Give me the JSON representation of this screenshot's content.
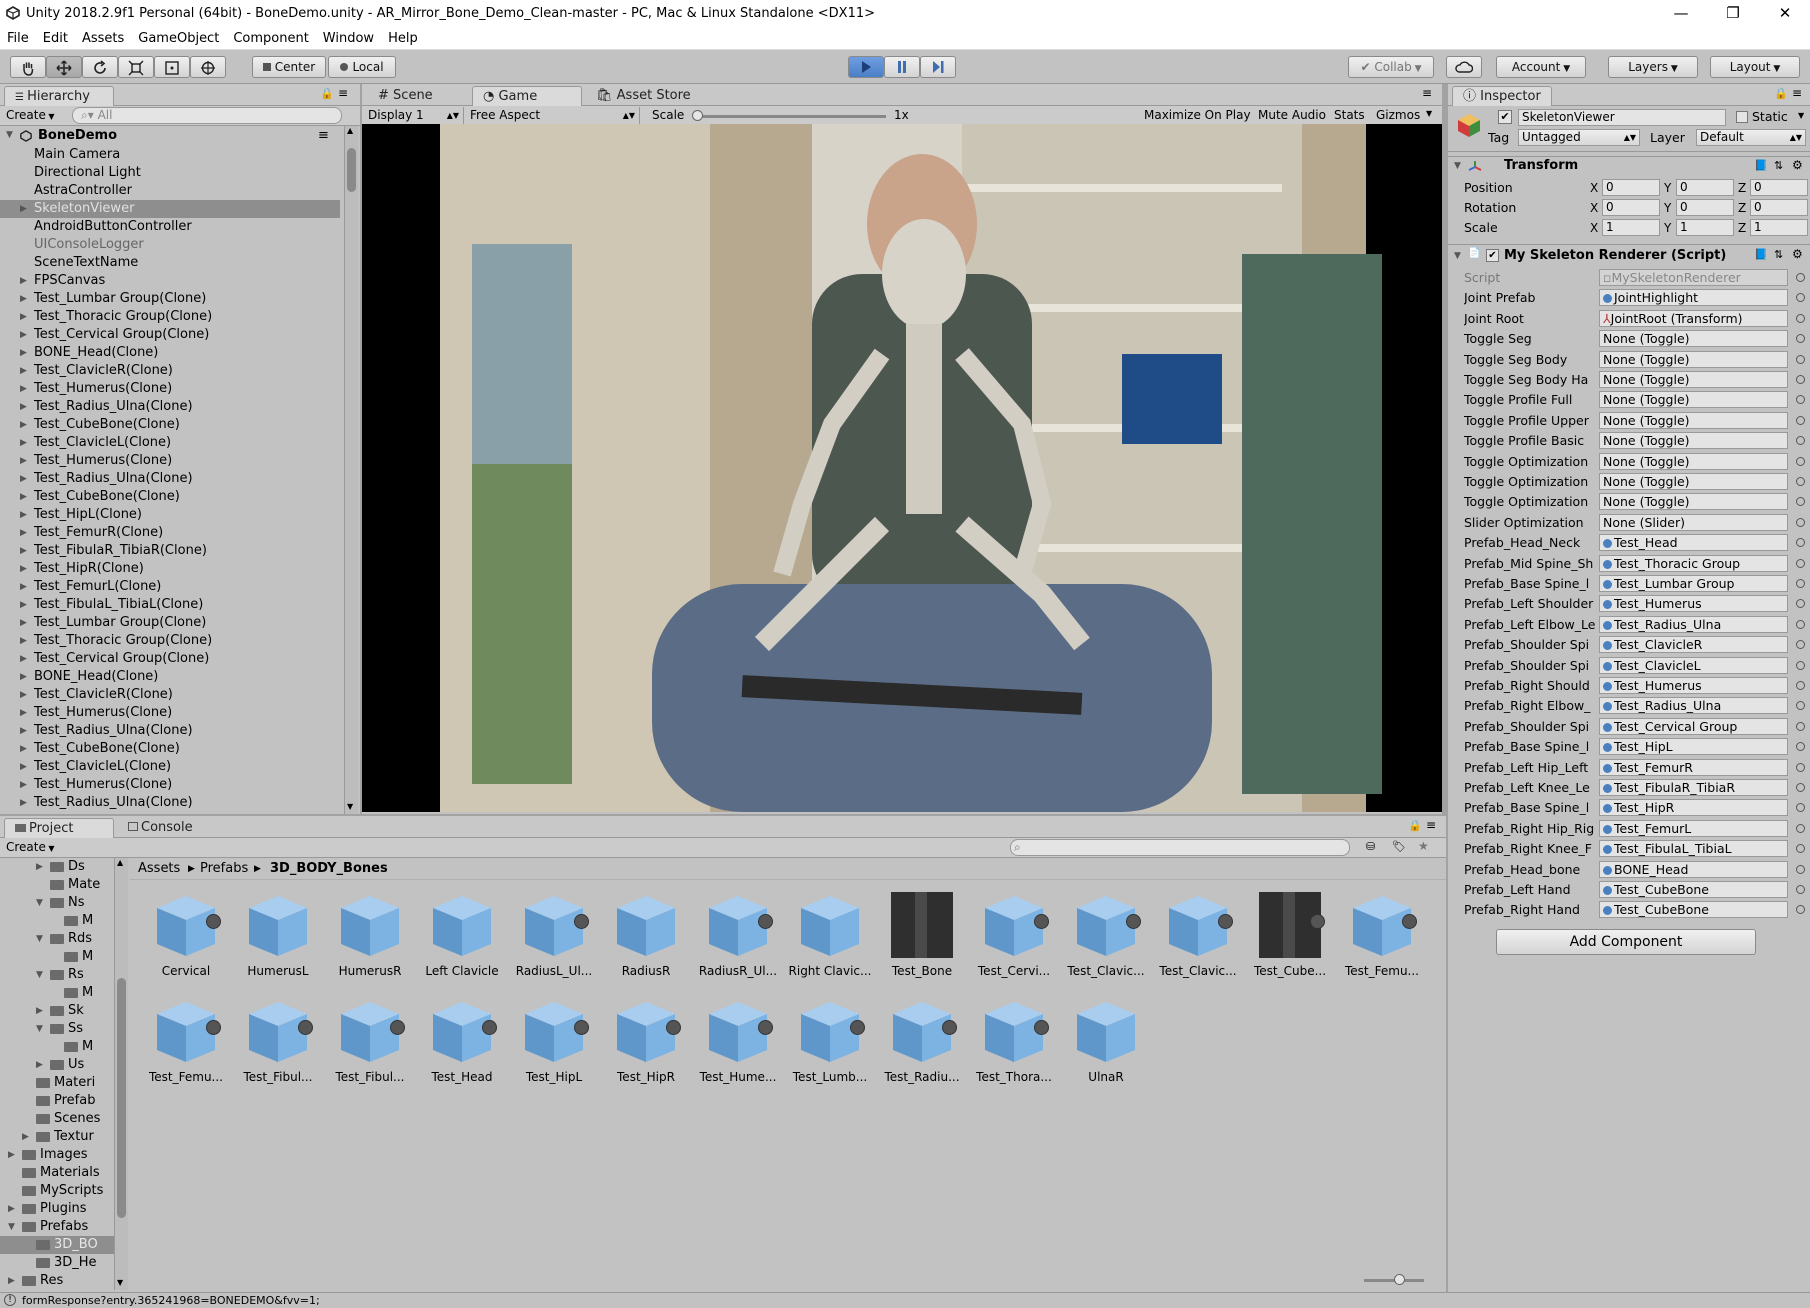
{
  "window": {
    "title": "Unity 2018.2.9f1 Personal (64bit) - BoneDemo.unity - AR_Mirror_Bone_Demo_Clean-master - PC, Mac & Linux Standalone <DX11>",
    "minimize": "—",
    "maximize": "❐",
    "close": "✕"
  },
  "menu": [
    "File",
    "Edit",
    "Assets",
    "GameObject",
    "Component",
    "Window",
    "Help"
  ],
  "toolbar": {
    "pivot": "Center",
    "space": "Local",
    "collab": "Collab",
    "account": "Account",
    "layers": "Layers",
    "layout": "Layout"
  },
  "hierarchy": {
    "tab": "Hierarchy",
    "create": "Create",
    "search_placeholder": "All",
    "scene": "BoneDemo",
    "items": [
      {
        "label": "Main Camera",
        "arrow": false,
        "dim": false
      },
      {
        "label": "Directional Light",
        "arrow": false,
        "dim": false
      },
      {
        "label": "AstraController",
        "arrow": false,
        "dim": false
      },
      {
        "label": "SkeletonViewer",
        "arrow": true,
        "dim": false,
        "selected": true
      },
      {
        "label": "AndroidButtonController",
        "arrow": false,
        "dim": false
      },
      {
        "label": "UIConsoleLogger",
        "arrow": false,
        "dim": true
      },
      {
        "label": "SceneTextName",
        "arrow": false,
        "dim": false
      },
      {
        "label": "FPSCanvas",
        "arrow": true,
        "dim": false
      },
      {
        "label": "Test_Lumbar Group(Clone)",
        "arrow": true,
        "dim": false
      },
      {
        "label": "Test_Thoracic Group(Clone)",
        "arrow": true,
        "dim": false
      },
      {
        "label": "Test_Cervical Group(Clone)",
        "arrow": true,
        "dim": false
      },
      {
        "label": "BONE_Head(Clone)",
        "arrow": true,
        "dim": false
      },
      {
        "label": "Test_ClavicleR(Clone)",
        "arrow": true,
        "dim": false
      },
      {
        "label": "Test_Humerus(Clone)",
        "arrow": true,
        "dim": false
      },
      {
        "label": "Test_Radius_Ulna(Clone)",
        "arrow": true,
        "dim": false
      },
      {
        "label": "Test_CubeBone(Clone)",
        "arrow": true,
        "dim": false
      },
      {
        "label": "Test_ClavicleL(Clone)",
        "arrow": true,
        "dim": false
      },
      {
        "label": "Test_Humerus(Clone)",
        "arrow": true,
        "dim": false
      },
      {
        "label": "Test_Radius_Ulna(Clone)",
        "arrow": true,
        "dim": false
      },
      {
        "label": "Test_CubeBone(Clone)",
        "arrow": true,
        "dim": false
      },
      {
        "label": "Test_HipL(Clone)",
        "arrow": true,
        "dim": false
      },
      {
        "label": "Test_FemurR(Clone)",
        "arrow": true,
        "dim": false
      },
      {
        "label": "Test_FibulaR_TibiaR(Clone)",
        "arrow": true,
        "dim": false
      },
      {
        "label": "Test_HipR(Clone)",
        "arrow": true,
        "dim": false
      },
      {
        "label": "Test_FemurL(Clone)",
        "arrow": true,
        "dim": false
      },
      {
        "label": "Test_FibulaL_TibiaL(Clone)",
        "arrow": true,
        "dim": false
      },
      {
        "label": "Test_Lumbar Group(Clone)",
        "arrow": true,
        "dim": false
      },
      {
        "label": "Test_Thoracic Group(Clone)",
        "arrow": true,
        "dim": false
      },
      {
        "label": "Test_Cervical Group(Clone)",
        "arrow": true,
        "dim": false
      },
      {
        "label": "BONE_Head(Clone)",
        "arrow": true,
        "dim": false
      },
      {
        "label": "Test_ClavicleR(Clone)",
        "arrow": true,
        "dim": false
      },
      {
        "label": "Test_Humerus(Clone)",
        "arrow": true,
        "dim": false
      },
      {
        "label": "Test_Radius_Ulna(Clone)",
        "arrow": true,
        "dim": false
      },
      {
        "label": "Test_CubeBone(Clone)",
        "arrow": true,
        "dim": false
      },
      {
        "label": "Test_ClavicleL(Clone)",
        "arrow": true,
        "dim": false
      },
      {
        "label": "Test_Humerus(Clone)",
        "arrow": true,
        "dim": false
      },
      {
        "label": "Test_Radius_Ulna(Clone)",
        "arrow": true,
        "dim": false
      }
    ]
  },
  "center": {
    "tabs": [
      "Scene",
      "Game",
      "Asset Store"
    ],
    "display": "Display 1",
    "aspect": "Free Aspect",
    "scale_label": "Scale",
    "scale_value": "1x",
    "scale_fraction": 0.0,
    "options": [
      "Maximize On Play",
      "Mute Audio",
      "Stats",
      "Gizmos"
    ]
  },
  "inspector": {
    "tab": "Inspector",
    "object_name": "SkeletonViewer",
    "static_label": "Static",
    "tag_label": "Tag",
    "tag_value": "Untagged",
    "layer_label": "Layer",
    "layer_value": "Default",
    "transform": {
      "title": "Transform",
      "rows": [
        {
          "label": "Position",
          "x": "0",
          "y": "0",
          "z": "0"
        },
        {
          "label": "Rotation",
          "x": "0",
          "y": "0",
          "z": "0"
        },
        {
          "label": "Scale",
          "x": "1",
          "y": "1",
          "z": "1"
        }
      ]
    },
    "script_component": {
      "title": "My Skeleton Renderer (Script)",
      "fields": [
        {
          "label": "Script",
          "value": "MySkeletonRenderer",
          "kind": "script"
        },
        {
          "label": "Joint Prefab",
          "value": "JointHighlight",
          "kind": "obj"
        },
        {
          "label": "Joint Root",
          "value": "JointRoot (Transform)",
          "kind": "transform"
        },
        {
          "label": "Toggle Seg",
          "value": "None (Toggle)",
          "kind": "none"
        },
        {
          "label": "Toggle Seg Body",
          "value": "None (Toggle)",
          "kind": "none"
        },
        {
          "label": "Toggle Seg Body Ha",
          "value": "None (Toggle)",
          "kind": "none"
        },
        {
          "label": "Toggle Profile Full",
          "value": "None (Toggle)",
          "kind": "none"
        },
        {
          "label": "Toggle Profile Upper",
          "value": "None (Toggle)",
          "kind": "none"
        },
        {
          "label": "Toggle Profile Basic",
          "value": "None (Toggle)",
          "kind": "none"
        },
        {
          "label": "Toggle Optimization",
          "value": "None (Toggle)",
          "kind": "none"
        },
        {
          "label": "Toggle Optimization",
          "value": "None (Toggle)",
          "kind": "none"
        },
        {
          "label": "Toggle Optimization",
          "value": "None (Toggle)",
          "kind": "none"
        },
        {
          "label": "Slider Optimization",
          "value": "None (Slider)",
          "kind": "none"
        },
        {
          "label": "Prefab_Head_Neck",
          "value": "Test_Head",
          "kind": "obj"
        },
        {
          "label": "Prefab_Mid Spine_Sh",
          "value": "Test_Thoracic Group",
          "kind": "obj"
        },
        {
          "label": "Prefab_Base Spine_l",
          "value": "Test_Lumbar Group",
          "kind": "obj"
        },
        {
          "label": "Prefab_Left Shoulder",
          "value": "Test_Humerus",
          "kind": "obj"
        },
        {
          "label": "Prefab_Left Elbow_Le",
          "value": "Test_Radius_Ulna",
          "kind": "obj"
        },
        {
          "label": "Prefab_Shoulder Spi",
          "value": "Test_ClavicleR",
          "kind": "obj"
        },
        {
          "label": "Prefab_Shoulder Spi",
          "value": "Test_ClavicleL",
          "kind": "obj"
        },
        {
          "label": "Prefab_Right Should",
          "value": "Test_Humerus",
          "kind": "obj"
        },
        {
          "label": "Prefab_Right Elbow_",
          "value": "Test_Radius_Ulna",
          "kind": "obj"
        },
        {
          "label": "Prefab_Shoulder Spi",
          "value": "Test_Cervical Group",
          "kind": "obj"
        },
        {
          "label": "Prefab_Base Spine_l",
          "value": "Test_HipL",
          "kind": "obj"
        },
        {
          "label": "Prefab_Left Hip_Left",
          "value": "Test_FemurR",
          "kind": "obj"
        },
        {
          "label": "Prefab_Left Knee_Le",
          "value": "Test_FibulaR_TibiaR",
          "kind": "obj"
        },
        {
          "label": "Prefab_Base Spine_l",
          "value": "Test_HipR",
          "kind": "obj"
        },
        {
          "label": "Prefab_Right Hip_Rig",
          "value": "Test_FemurL",
          "kind": "obj"
        },
        {
          "label": "Prefab_Right Knee_F",
          "value": "Test_FibulaL_TibiaL",
          "kind": "obj"
        },
        {
          "label": "Prefab_Head_bone",
          "value": "BONE_Head",
          "kind": "obj"
        },
        {
          "label": "Prefab_Left Hand",
          "value": "Test_CubeBone",
          "kind": "obj"
        },
        {
          "label": "Prefab_Right Hand",
          "value": "Test_CubeBone",
          "kind": "obj"
        }
      ]
    },
    "add_component": "Add Component"
  },
  "project": {
    "tabs": [
      "Project",
      "Console"
    ],
    "create": "Create",
    "breadcrumb": [
      "Assets",
      "Prefabs",
      "3D_BODY_Bones"
    ],
    "tree": [
      {
        "label": "Ds",
        "indent": 3,
        "arrow": "right"
      },
      {
        "label": "Mate",
        "indent": 3,
        "arrow": "none"
      },
      {
        "label": "Ns",
        "indent": 3,
        "arrow": "down"
      },
      {
        "label": "M",
        "indent": 4,
        "arrow": "none"
      },
      {
        "label": "Rds",
        "indent": 3,
        "arrow": "down"
      },
      {
        "label": "M",
        "indent": 4,
        "arrow": "none"
      },
      {
        "label": "Rs",
        "indent": 3,
        "arrow": "down"
      },
      {
        "label": "M",
        "indent": 4,
        "arrow": "none"
      },
      {
        "label": "Sk",
        "indent": 3,
        "arrow": "right"
      },
      {
        "label": "Ss",
        "indent": 3,
        "arrow": "down"
      },
      {
        "label": "M",
        "indent": 4,
        "arrow": "none"
      },
      {
        "label": "Us",
        "indent": 3,
        "arrow": "right"
      },
      {
        "label": "Materi",
        "indent": 2,
        "arrow": "none"
      },
      {
        "label": "Prefab",
        "indent": 2,
        "arrow": "none"
      },
      {
        "label": "Scenes",
        "indent": 2,
        "arrow": "none"
      },
      {
        "label": "Textur",
        "indent": 2,
        "arrow": "right"
      },
      {
        "label": "Images",
        "indent": 1,
        "arrow": "right"
      },
      {
        "label": "Materials",
        "indent": 1,
        "arrow": "none"
      },
      {
        "label": "MyScripts",
        "indent": 1,
        "arrow": "none"
      },
      {
        "label": "Plugins",
        "indent": 1,
        "arrow": "right"
      },
      {
        "label": "Prefabs",
        "indent": 1,
        "arrow": "down"
      },
      {
        "label": "3D_BO",
        "indent": 2,
        "arrow": "none",
        "selected": true
      },
      {
        "label": "3D_He",
        "indent": 2,
        "arrow": "none"
      },
      {
        "label": "Res",
        "indent": 1,
        "arrow": "right"
      }
    ],
    "assets": [
      {
        "label": "Cervical",
        "kind": "cube",
        "play": true
      },
      {
        "label": "HumerusL",
        "kind": "cube",
        "play": false
      },
      {
        "label": "HumerusR",
        "kind": "cube",
        "play": false
      },
      {
        "label": "Left Clavicle",
        "kind": "cube",
        "play": false
      },
      {
        "label": "RadiusL_Ul...",
        "kind": "cube",
        "play": true
      },
      {
        "label": "RadiusR",
        "kind": "cube",
        "play": false
      },
      {
        "label": "RadiusR_Ul...",
        "kind": "cube",
        "play": true
      },
      {
        "label": "Right Clavic...",
        "kind": "cube",
        "play": false
      },
      {
        "label": "Test_Bone",
        "kind": "dark",
        "play": false
      },
      {
        "label": "Test_Cervi...",
        "kind": "cube",
        "play": true
      },
      {
        "label": "Test_Clavic...",
        "kind": "cube",
        "play": true
      },
      {
        "label": "Test_Clavic...",
        "kind": "cube",
        "play": true
      },
      {
        "label": "Test_Cube...",
        "kind": "dark",
        "play": true
      },
      {
        "label": "Test_Femu...",
        "kind": "cube",
        "play": true
      },
      {
        "label": "Test_Femu...",
        "kind": "cube",
        "play": true
      },
      {
        "label": "Test_Fibul...",
        "kind": "cube",
        "play": true
      },
      {
        "label": "Test_Fibul...",
        "kind": "cube",
        "play": true
      },
      {
        "label": "Test_Head",
        "kind": "cube",
        "play": true
      },
      {
        "label": "Test_HipL",
        "kind": "cube",
        "play": true
      },
      {
        "label": "Test_HipR",
        "kind": "cube",
        "play": true
      },
      {
        "label": "Test_Hume...",
        "kind": "cube",
        "play": true
      },
      {
        "label": "Test_Lumb...",
        "kind": "cube",
        "play": true
      },
      {
        "label": "Test_Radiu...",
        "kind": "cube",
        "play": true
      },
      {
        "label": "Test_Thora...",
        "kind": "cube",
        "play": true
      },
      {
        "label": "UlnaR",
        "kind": "cube",
        "play": false
      }
    ]
  },
  "statusbar": {
    "text": "formResponse?entry.365241968=BONEDEMO&fvv=1;"
  },
  "colors": {
    "panel_bg": "#c2c2c2",
    "play_active": "#4b7fc7",
    "selection": "#8e8e8e",
    "cube_blue": "#6fa6d6"
  }
}
